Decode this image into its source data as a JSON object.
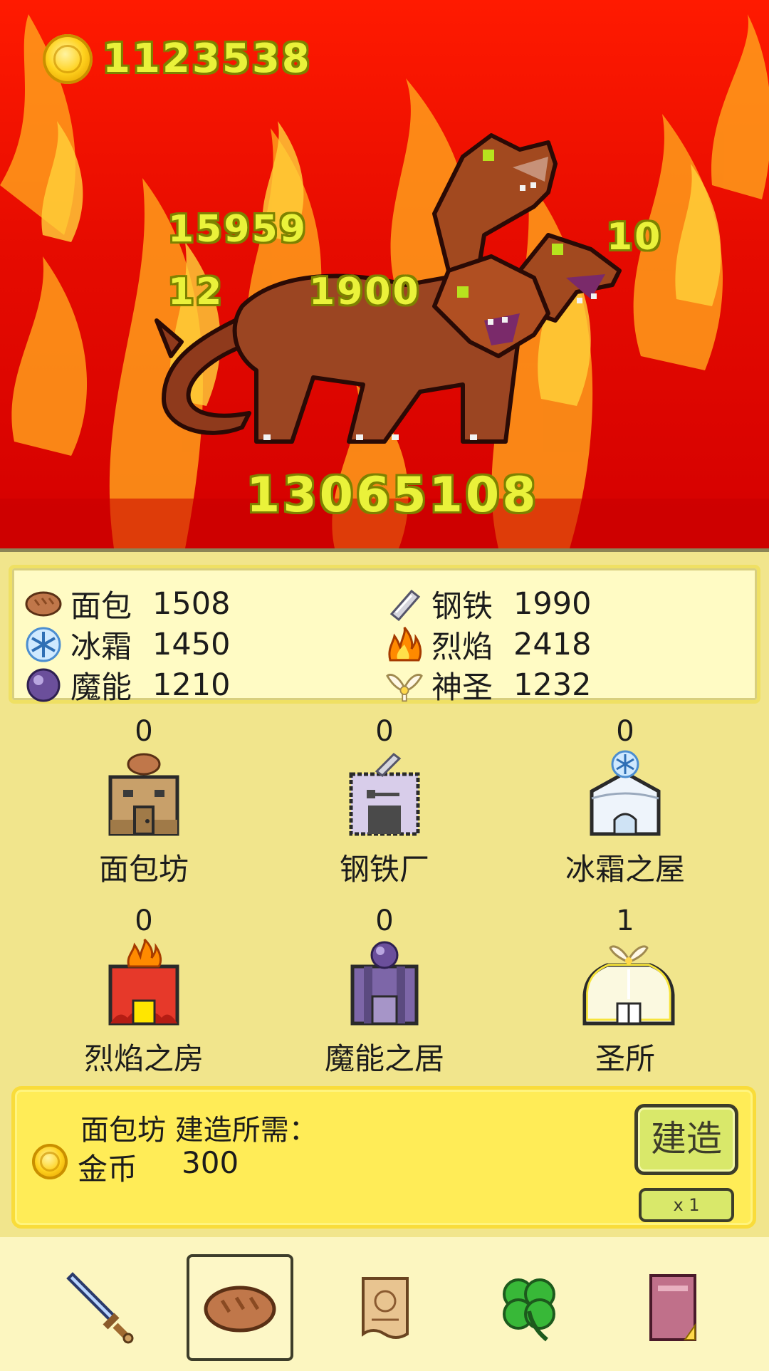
{
  "hud": {
    "gold": "1123538",
    "gold_icon": "gold-coin-icon"
  },
  "battle": {
    "enemy": "three-headed-hellhound-sprite",
    "damage_numbers": [
      "15959",
      "12",
      "1900",
      "10"
    ],
    "boss_hp": "13065108"
  },
  "resources": [
    {
      "icon": "bread-icon",
      "name": "面包",
      "value": "1508"
    },
    {
      "icon": "steel-icon",
      "name": "钢铁",
      "value": "1990"
    },
    {
      "icon": "frost-icon",
      "name": "冰霜",
      "value": "1450"
    },
    {
      "icon": "flame-icon",
      "name": "烈焰",
      "value": "2418"
    },
    {
      "icon": "magic-orb-icon",
      "name": "魔能",
      "value": "1210"
    },
    {
      "icon": "holy-wings-icon",
      "name": "神圣",
      "value": "1232"
    }
  ],
  "buildings": [
    {
      "name": "面包坊",
      "count": "0"
    },
    {
      "name": "钢铁厂",
      "count": "0"
    },
    {
      "name": "冰霜之屋",
      "count": "0"
    },
    {
      "name": "烈焰之房",
      "count": "0"
    },
    {
      "name": "魔能之居",
      "count": "0"
    },
    {
      "name": "圣所",
      "count": "1"
    }
  ],
  "build_panel": {
    "title": "面包坊 建造所需：",
    "cost_name": "金币",
    "cost_value": "300",
    "button_label": "建造",
    "multiplier": "x 1"
  },
  "tabs": [
    {
      "icon": "sword-icon",
      "active": false
    },
    {
      "icon": "bread-icon",
      "active": true
    },
    {
      "icon": "scroll-icon",
      "active": false
    },
    {
      "icon": "clover-icon",
      "active": false
    },
    {
      "icon": "book-icon",
      "active": false
    }
  ],
  "colors": {
    "scene_red": "#e60b00",
    "number_yellow": "#eaf23a",
    "panel": "#f1e58c",
    "build_box": "#ffec57"
  }
}
